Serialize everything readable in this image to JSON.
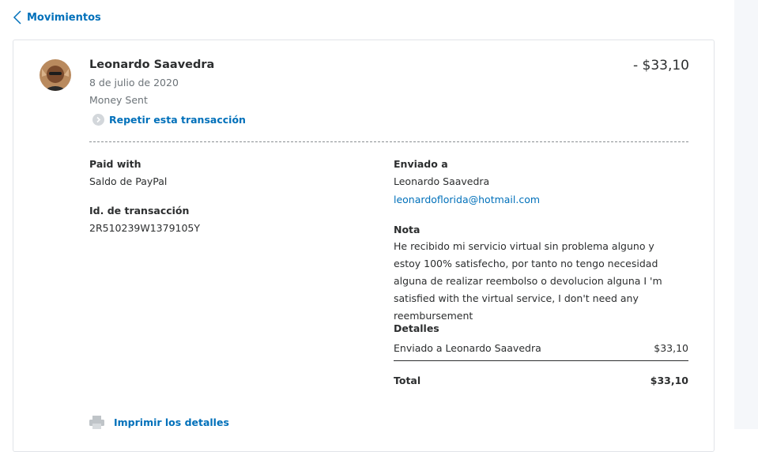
{
  "nav": {
    "back_label": "Movimientos"
  },
  "transaction": {
    "name": "Leonardo Saavedra",
    "date": "8 de julio de 2020",
    "type": "Money Sent",
    "repeat_label": "Repetir esta transacción",
    "amount": "- $33,10"
  },
  "paid_with": {
    "label": "Paid with",
    "value": "Saldo de PayPal"
  },
  "transaction_id": {
    "label": "Id. de transacción",
    "value": "2R510239W1379105Y"
  },
  "sent_to": {
    "label": "Enviado a",
    "name": "Leonardo Saavedra",
    "email": "leonardoflorida@hotmail.com"
  },
  "note": {
    "label": "Nota",
    "text": "He recibido mi servicio virtual sin problema alguno y estoy 100% satisfecho, por tanto no tengo necesidad alguna de realizar reembolso o devolucion alguna I 'm satisfied with the virtual service, I don't need any reembursement"
  },
  "details": {
    "label": "Detalles",
    "line_item": {
      "description": "Enviado a Leonardo Saavedra",
      "amount": "$33,10"
    },
    "total_label": "Total",
    "total_amount": "$33,10"
  },
  "print": {
    "label": "Imprimir los detalles"
  },
  "colors": {
    "link": "#0070ba",
    "text": "#2c2e2f",
    "muted": "#6c7378"
  }
}
